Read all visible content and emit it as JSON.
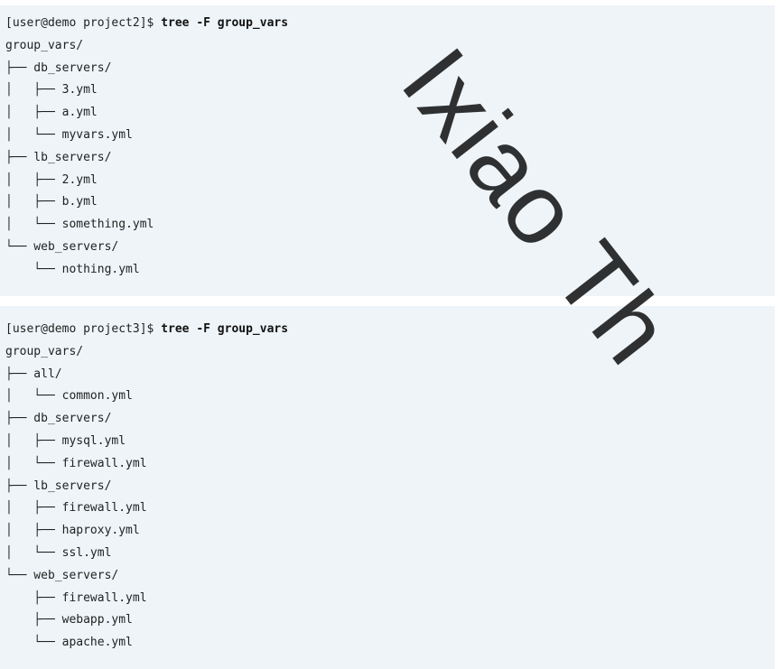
{
  "blocks": [
    {
      "prompt": "[user@demo project2]$ ",
      "command": "tree -F group_vars",
      "lines": [
        "group_vars/",
        "├── db_servers/",
        "│   ├── 3.yml",
        "│   ├── a.yml",
        "│   └── myvars.yml",
        "├── lb_servers/",
        "│   ├── 2.yml",
        "│   ├── b.yml",
        "│   └── something.yml",
        "└── web_servers/",
        "    └── nothing.yml"
      ]
    },
    {
      "prompt": "[user@demo project3]$ ",
      "command": "tree -F group_vars",
      "lines": [
        "group_vars/",
        "├── all/",
        "│   └── common.yml",
        "├── db_servers/",
        "│   ├── mysql.yml",
        "│   └── firewall.yml",
        "├── lb_servers/",
        "│   ├── firewall.yml",
        "│   ├── haproxy.yml",
        "│   └── ssl.yml",
        "└── web_servers/",
        "    ├── firewall.yml",
        "    ├── webapp.yml",
        "    └── apache.yml"
      ]
    }
  ],
  "watermark": "Ixiao Th"
}
